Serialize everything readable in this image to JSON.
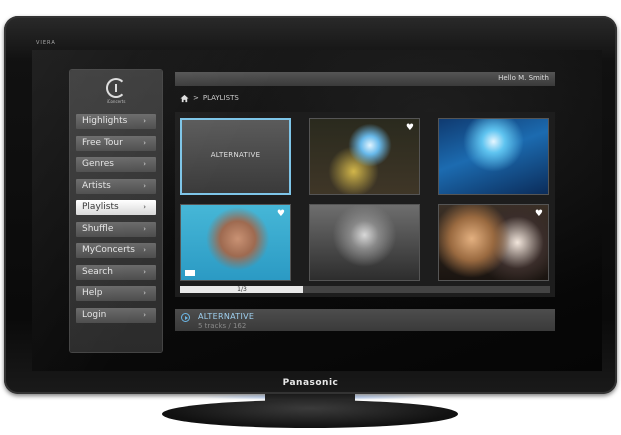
{
  "tv": {
    "small_brand": "VIERA",
    "logo": "Panasonic"
  },
  "app": {
    "name": "iConcerts"
  },
  "sidebar": {
    "items": [
      {
        "label": "Highlights",
        "active": false
      },
      {
        "label": "Free Tour",
        "active": false
      },
      {
        "label": "Genres",
        "active": false
      },
      {
        "label": "Artists",
        "active": false
      },
      {
        "label": "Playlists",
        "active": true
      },
      {
        "label": "Shuffle",
        "active": false
      },
      {
        "label": "MyConcerts",
        "active": false
      },
      {
        "label": "Search",
        "active": false
      },
      {
        "label": "Help",
        "active": false
      },
      {
        "label": "Login",
        "active": false
      }
    ],
    "chevron": "›"
  },
  "header": {
    "greeting": "Hello M. Smith"
  },
  "breadcrumb": {
    "home_icon": "home-icon",
    "separator": ">",
    "current": "PLAYLISTS"
  },
  "grid": {
    "tiles": [
      {
        "label": "ALTERNATIVE",
        "selected": true,
        "heart": false,
        "explicit": false
      },
      {
        "label": "",
        "selected": false,
        "heart": true,
        "explicit": false
      },
      {
        "label": "",
        "selected": false,
        "heart": false,
        "explicit": false
      },
      {
        "label": "",
        "selected": false,
        "heart": true,
        "explicit": true
      },
      {
        "label": "",
        "selected": false,
        "heart": false,
        "explicit": false
      },
      {
        "label": "",
        "selected": false,
        "heart": true,
        "explicit": false
      }
    ],
    "heart_glyph": "♥"
  },
  "pager": {
    "label": "1/3",
    "progress": 0.333
  },
  "now_selected": {
    "title": "ALTERNATIVE",
    "subtitle": "5 tracks / 162"
  },
  "colors": {
    "accent": "#7ec5e8",
    "active_menu_bg": "#ffffff",
    "menu_bg": "#5a5a5a"
  }
}
